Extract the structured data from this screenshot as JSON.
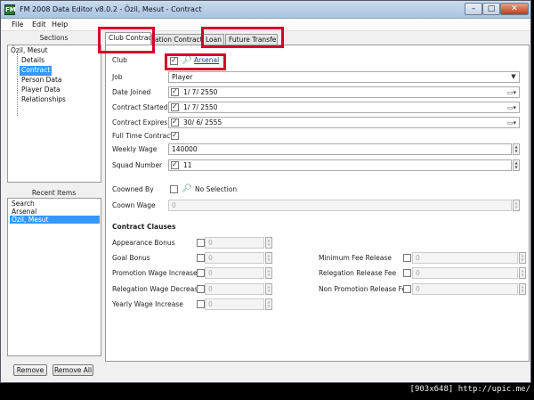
{
  "window": {
    "title": "FM 2008 Data Editor v8.0.2 - Özil, Mesut - Contract",
    "app_icon_text": "FM",
    "minimize_icon": "minimize-icon",
    "maximize_icon": "maximize-icon",
    "close_icon": "close-icon"
  },
  "menu": {
    "file": "File",
    "edit": "Edit",
    "help": "Help"
  },
  "sections": {
    "heading": "Sections",
    "root": "Özil, Mesut",
    "items": [
      "Details",
      "Contract",
      "Person Data",
      "Player Data",
      "Relationships"
    ],
    "selected": "Contract"
  },
  "recent": {
    "heading": "Recent Items",
    "items": [
      "Search",
      "Arsenal",
      "Özil, Mesut"
    ],
    "selected": "Özil, Mesut",
    "remove_label": "Remove",
    "remove_all_label": "Remove All"
  },
  "tabs": [
    "Club Contract",
    "Nation Contract",
    "Loan",
    "Future Transfer"
  ],
  "tab_visible": [
    "Club Contract",
    "ation Contract",
    "Loan",
    "Future Transfer"
  ],
  "form": {
    "club_label": "Club",
    "club_value": "Arsenal",
    "job_label": "Job",
    "job_value": "Player",
    "date_joined_label": "Date Joined",
    "date_joined_value": "1/  7/  2550",
    "contract_started_label": "Contract Started",
    "contract_started_value": "1/  7/  2550",
    "contract_expires_label": "Contract Expires",
    "contract_expires_value": "30/  6/  2555",
    "full_time_label": "Full Time Contract",
    "weekly_wage_label": "Weekly Wage",
    "weekly_wage_value": "140000",
    "squad_number_label": "Squad Number",
    "squad_number_value": "11",
    "coowned_label": "Coowned By",
    "coowned_value": "No Selection",
    "coown_wage_label": "Coown Wage",
    "coown_wage_value": "0"
  },
  "clauses": {
    "heading": "Contract Clauses",
    "left": [
      {
        "label": "Appearance Bonus",
        "value": "0"
      },
      {
        "label": "Goal Bonus",
        "value": "0"
      },
      {
        "label": "Promotion Wage Increase",
        "value": "0"
      },
      {
        "label": "Relegation Wage Decrease",
        "value": "0"
      },
      {
        "label": "Yearly Wage Increase",
        "value": "0"
      }
    ],
    "right": [
      {
        "label": "Minimum Fee Release",
        "value": "0"
      },
      {
        "label": "Relegation Release Fee",
        "value": "0"
      },
      {
        "label": "Non Promotion Release Fee",
        "value": "0"
      }
    ]
  },
  "watermark": "[903x648] http://upic.me/",
  "colors": {
    "highlight": "#3399ff",
    "annotation_red": "#d5002a"
  }
}
